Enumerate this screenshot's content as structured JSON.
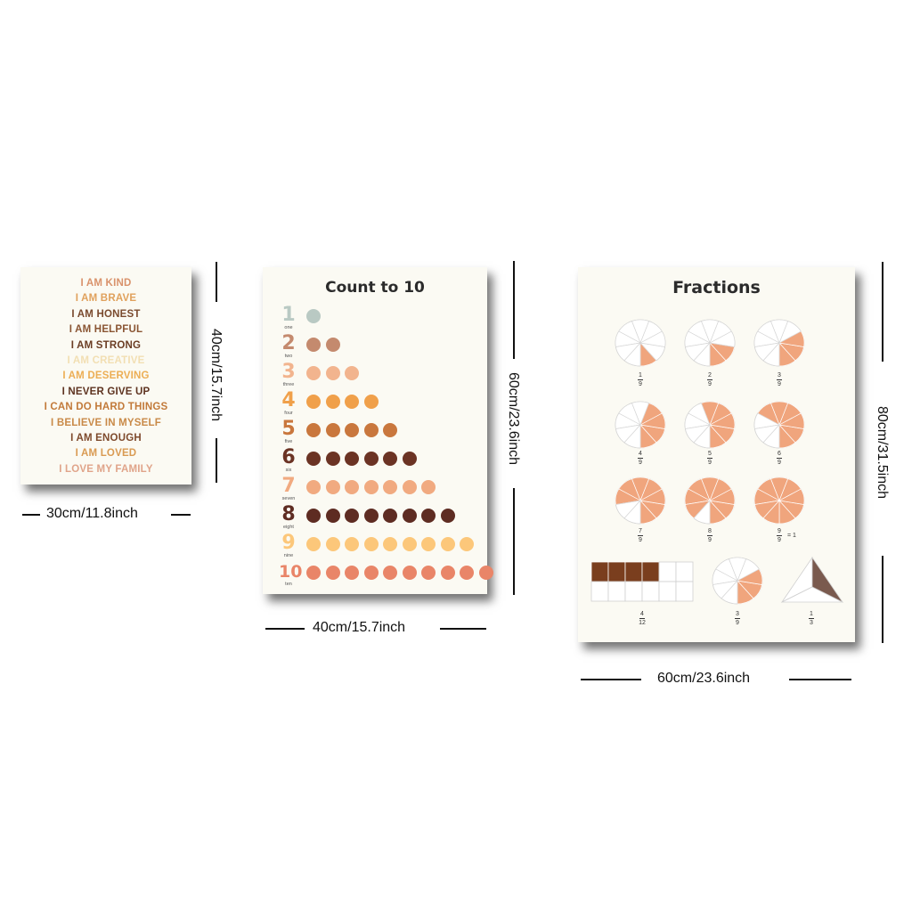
{
  "affirmations": {
    "lines": [
      {
        "text": "I AM KIND",
        "color": "#d9926b"
      },
      {
        "text": "I AM BRAVE",
        "color": "#e0a15c"
      },
      {
        "text": "I AM HONEST",
        "color": "#7a4a2e"
      },
      {
        "text": "I AM HELPFUL",
        "color": "#8a5533"
      },
      {
        "text": "I AM STRONG",
        "color": "#6b3d24"
      },
      {
        "text": "I AM CREATIVE",
        "color": "#f2dfb3"
      },
      {
        "text": "I AM DESERVING",
        "color": "#ecae55"
      },
      {
        "text": "I NEVER GIVE UP",
        "color": "#5e3320"
      },
      {
        "text": "I CAN DO HARD THINGS",
        "color": "#c27a3a"
      },
      {
        "text": "I BELIEVE IN MYSELF",
        "color": "#c98a48"
      },
      {
        "text": "I AM ENOUGH",
        "color": "#7e4a2c"
      },
      {
        "text": "I AM LOVED",
        "color": "#d99a52"
      },
      {
        "text": "I LOVE MY FAMILY",
        "color": "#e0a48a"
      }
    ]
  },
  "count": {
    "title": "Count to 10",
    "rows": [
      {
        "num": "1",
        "word": "one",
        "count": 1,
        "color": "#b9c9c3"
      },
      {
        "num": "2",
        "word": "two",
        "count": 2,
        "color": "#c48a6e"
      },
      {
        "num": "3",
        "word": "three",
        "count": 3,
        "color": "#f2b48e"
      },
      {
        "num": "4",
        "word": "four",
        "count": 4,
        "color": "#f0a04a"
      },
      {
        "num": "5",
        "word": "five",
        "count": 5,
        "color": "#c9773d"
      },
      {
        "num": "6",
        "word": "six",
        "count": 6,
        "color": "#6b3324"
      },
      {
        "num": "7",
        "word": "seven",
        "count": 7,
        "color": "#f1aa80"
      },
      {
        "num": "8",
        "word": "eight",
        "count": 8,
        "color": "#5e2c22"
      },
      {
        "num": "9",
        "word": "nine",
        "count": 9,
        "color": "#fcc77a"
      },
      {
        "num": "10",
        "word": "ten",
        "count": 10,
        "color": "#e98568"
      }
    ]
  },
  "fractions": {
    "title": "Fractions",
    "fill_color": "#f0a57d",
    "rect_fill_color": "#7a3e1e",
    "triangle_fill_color": "#7a5a4e",
    "items": [
      {
        "num": "1",
        "den": "9",
        "shaded": 1
      },
      {
        "num": "2",
        "den": "9",
        "shaded": 2
      },
      {
        "num": "3",
        "den": "9",
        "shaded": 3
      },
      {
        "num": "4",
        "den": "9",
        "shaded": 4
      },
      {
        "num": "5",
        "den": "9",
        "shaded": 5
      },
      {
        "num": "6",
        "den": "9",
        "shaded": 6
      },
      {
        "num": "7",
        "den": "9",
        "shaded": 7
      },
      {
        "num": "8",
        "den": "9",
        "shaded": 8
      },
      {
        "num": "9",
        "den": "9",
        "shaded": 9
      }
    ],
    "equals_one": "= 1",
    "rect": {
      "num": "4",
      "den": "12",
      "shaded": 4,
      "total": 12
    },
    "bottom_pie": {
      "num": "3",
      "den": "9",
      "shaded": 3
    },
    "triangle": {
      "num": "1",
      "den": "3",
      "shaded": 1
    }
  },
  "dimensions": {
    "p1_width": "30cm/11.8inch",
    "p1_height": "40cm/15.7inch",
    "p2_width": "40cm/15.7inch",
    "p2_height": "60cm/23.6inch",
    "p3_width": "60cm/23.6inch",
    "p3_height": "80cm/31.5inch"
  }
}
